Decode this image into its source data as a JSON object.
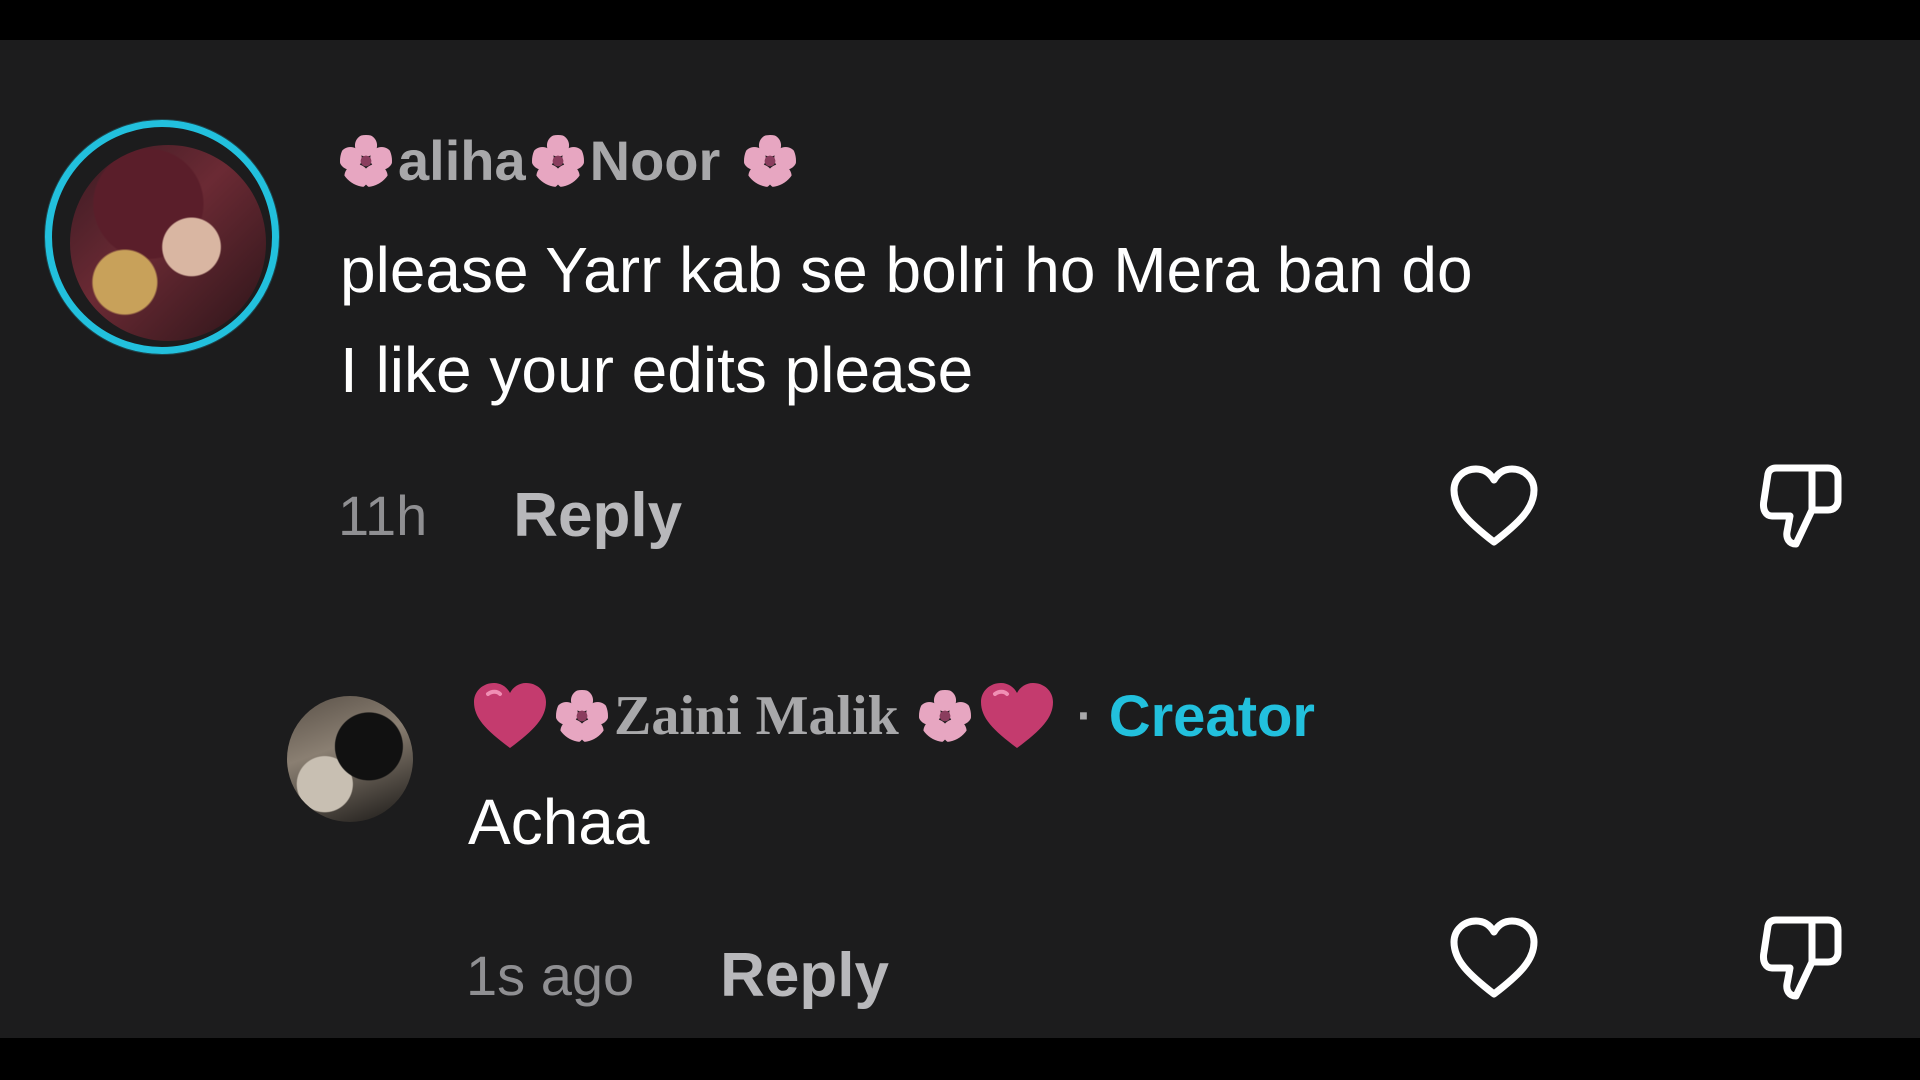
{
  "comment": {
    "author_name_a": "aliha",
    "author_name_b": "Noor",
    "text_line1": "please Yarr kab se bolri ho Mera ban do",
    "text_line2": "I like your edits please",
    "time": "11h",
    "reply_label": "Reply"
  },
  "reply": {
    "author_name": "Zaini Malik",
    "separator": "·",
    "badge": "Creator",
    "text": "Achaa",
    "time": "1s ago",
    "reply_label": "Reply"
  },
  "icons": {
    "like": "heart-outline-icon",
    "dislike": "thumbs-down-outline-icon",
    "decor": "cherry-blossom-icon",
    "heart_emoji": "pink-heart-icon"
  },
  "colors": {
    "background": "#1c1c1d",
    "accent": "#22c0dd",
    "text_primary": "#ffffff",
    "text_secondary": "#a8a8aa"
  }
}
